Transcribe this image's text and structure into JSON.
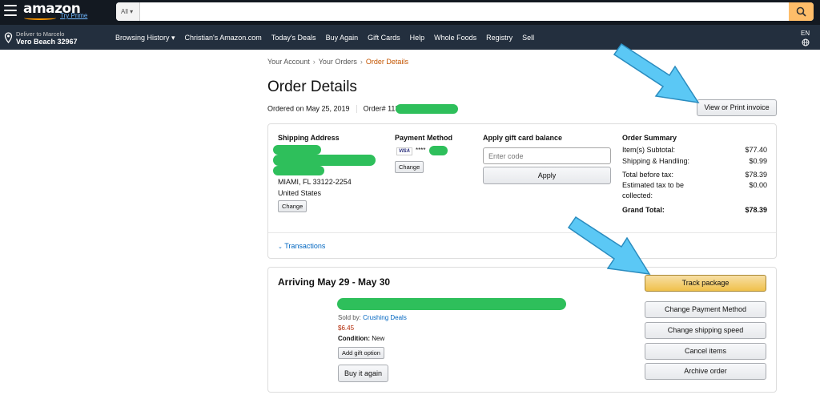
{
  "header": {
    "logo": "amazon",
    "try_prime": "Try Prime",
    "search_dept": "All",
    "search_placeholder": "",
    "deliver_to_line1": "Deliver to Marcelo",
    "deliver_to_line2": "Vero Beach 32967",
    "nav_links": [
      "Browsing History ▾",
      "Christian's Amazon.com",
      "Today's Deals",
      "Buy Again",
      "Gift Cards",
      "Help",
      "Whole Foods",
      "Registry",
      "Sell"
    ],
    "lang": "EN"
  },
  "breadcrumb": {
    "items": [
      "Your Account",
      "Your Orders"
    ],
    "separator": "›",
    "current": "Order Details"
  },
  "page": {
    "title": "Order Details",
    "ordered_on": "Ordered on May 25, 2019",
    "order_prefix": "Order# 113",
    "invoice_button": "View or Print invoice"
  },
  "summary": {
    "shipping_title": "Shipping Address",
    "address_city": "MIAMI, FL 33122-2254",
    "address_country": "United States",
    "address_change": "Change",
    "payment_title": "Payment Method",
    "card_brand": "VISA",
    "card_mask": "****",
    "payment_change": "Change",
    "gift_title": "Apply gift card balance",
    "gift_placeholder": "Enter code",
    "apply_button": "Apply",
    "order_summary_title": "Order Summary",
    "rows": [
      {
        "label": "Item(s) Subtotal:",
        "value": "$77.40"
      },
      {
        "label": "Shipping & Handling:",
        "value": "$0.99"
      },
      {
        "label": "Total before tax:",
        "value": "$78.39"
      },
      {
        "label": "Estimated tax to be",
        "value": "$0.00"
      }
    ],
    "tax_label_line2": "collected:",
    "grand_total_label": "Grand Total:",
    "grand_total_value": "$78.39",
    "transactions_link": "Transactions"
  },
  "shipment": {
    "arriving": "Arriving May 29 - May 30",
    "sold_by_label": "Sold by:",
    "seller": "Crushing Deals",
    "price": "$6.45",
    "condition_label": "Condition:",
    "condition_value": "New",
    "gift_option_button": "Add gift option",
    "buy_again_button": "Buy it again",
    "actions": [
      "Track package",
      "Change Payment Method",
      "Change shipping speed",
      "Cancel items",
      "Archive order"
    ]
  },
  "colors": {
    "header_bg": "#131921",
    "nav_bg": "#232f3e",
    "accent": "#f90",
    "primary_button": "#f0c14b",
    "redaction": "#2ebf5b",
    "annotation_arrow": "#5bc8f5",
    "price": "#b12704",
    "link": "#0066c0"
  }
}
